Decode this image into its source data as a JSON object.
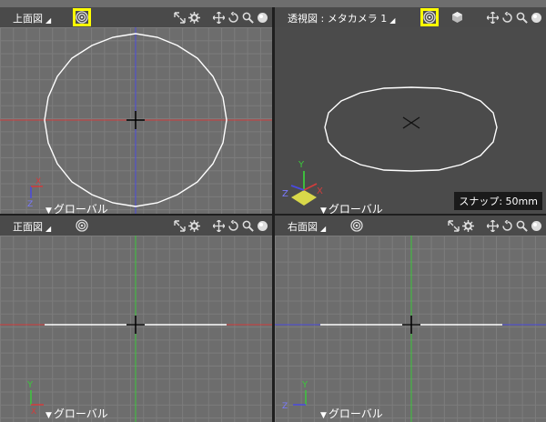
{
  "colors": {
    "highlight": "#ffff00",
    "axis_x": "#d23c3c",
    "axis_y": "#3cc83c",
    "axis_z": "#4a4ae0",
    "curve": "#ffffff"
  },
  "viewports": {
    "top": {
      "title": "上面図",
      "global_label": "グローバル",
      "active_camera_icon": "target-icon"
    },
    "perspective": {
      "title": "透視図 : メタカメラ 1",
      "global_label": "グローバル",
      "snap_label": "スナップ: 50mm",
      "active_camera_icon": "target-icon"
    },
    "front": {
      "title": "正面図",
      "global_label": "グローバル"
    },
    "right": {
      "title": "右面図",
      "global_label": "グローバル"
    }
  },
  "axes_letters": {
    "x": "X",
    "y": "Y",
    "z": "Z"
  },
  "toolbar_icons": [
    "fit-icon",
    "pan-icon",
    "rotate-icon",
    "zoom-icon",
    "display-mode-icon"
  ]
}
